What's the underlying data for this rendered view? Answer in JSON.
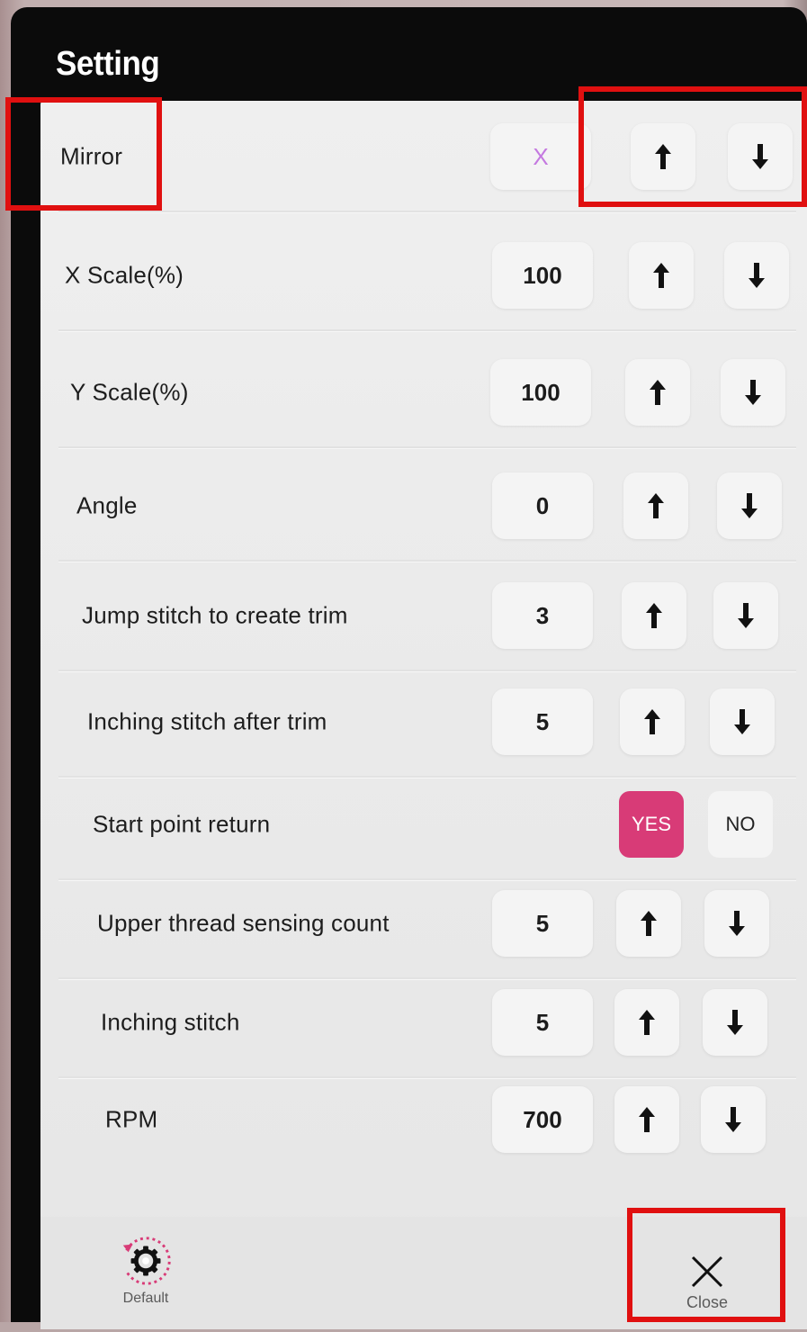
{
  "dialog": {
    "title": "Setting"
  },
  "rows": [
    {
      "label": "Mirror",
      "value": "X",
      "value_color": "#c479e0",
      "type": "stepper"
    },
    {
      "label": "X Scale(%)",
      "value": "100",
      "type": "stepper"
    },
    {
      "label": "Y Scale(%)",
      "value": "100",
      "type": "stepper"
    },
    {
      "label": "Angle",
      "value": "0",
      "type": "stepper"
    },
    {
      "label": "Jump stitch to create trim",
      "value": "3",
      "type": "stepper"
    },
    {
      "label": "Inching stitch after trim",
      "value": "5",
      "type": "stepper"
    },
    {
      "label": "Start point return",
      "type": "toggle",
      "yes_label": "YES",
      "no_label": "NO",
      "selected": "YES"
    },
    {
      "label": "Upper thread sensing count",
      "value": "5",
      "type": "stepper"
    },
    {
      "label": "Inching stitch",
      "value": "5",
      "type": "stepper"
    },
    {
      "label": "RPM",
      "value": "700",
      "type": "stepper"
    }
  ],
  "footer": {
    "default_label": "Default",
    "close_label": "Close"
  },
  "icons": {
    "up": "arrow-up-icon",
    "down": "arrow-down-icon",
    "default": "gear-reset-icon",
    "close": "close-icon"
  },
  "colors": {
    "accent_yes": "#d83b77",
    "highlight": "#e01010",
    "mirror_value": "#c479e0"
  }
}
